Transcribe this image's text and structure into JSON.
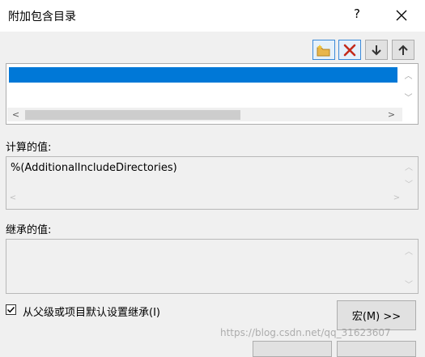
{
  "window": {
    "title": "附加包含目录",
    "help_glyph": "?"
  },
  "toolbar": {
    "new_line_icon": "new-folder-icon",
    "delete_icon": "delete-x-icon",
    "move_down_icon": "arrow-down-icon",
    "move_up_icon": "arrow-up-icon",
    "colors": {
      "delete": "#c42b1c",
      "folder": "#e8b64c"
    }
  },
  "list": {
    "selected_color": "#0078d7",
    "scroll_left_glyph": "<",
    "scroll_right_glyph": ">",
    "scroll_up_glyph": "︿",
    "scroll_down_glyph": "﹀"
  },
  "computed": {
    "label": "计算的值:",
    "value": "%(AdditionalIncludeDirectories)"
  },
  "inherited": {
    "label": "继承的值:",
    "value": ""
  },
  "inherit_checkbox": {
    "label": "从父级或项目默认设置继承(I)",
    "checked": true,
    "check_glyph": "✓"
  },
  "macro_button": {
    "label": "宏(M) >>"
  },
  "watermark": "https://blog.csdn.net/qq_31623607"
}
